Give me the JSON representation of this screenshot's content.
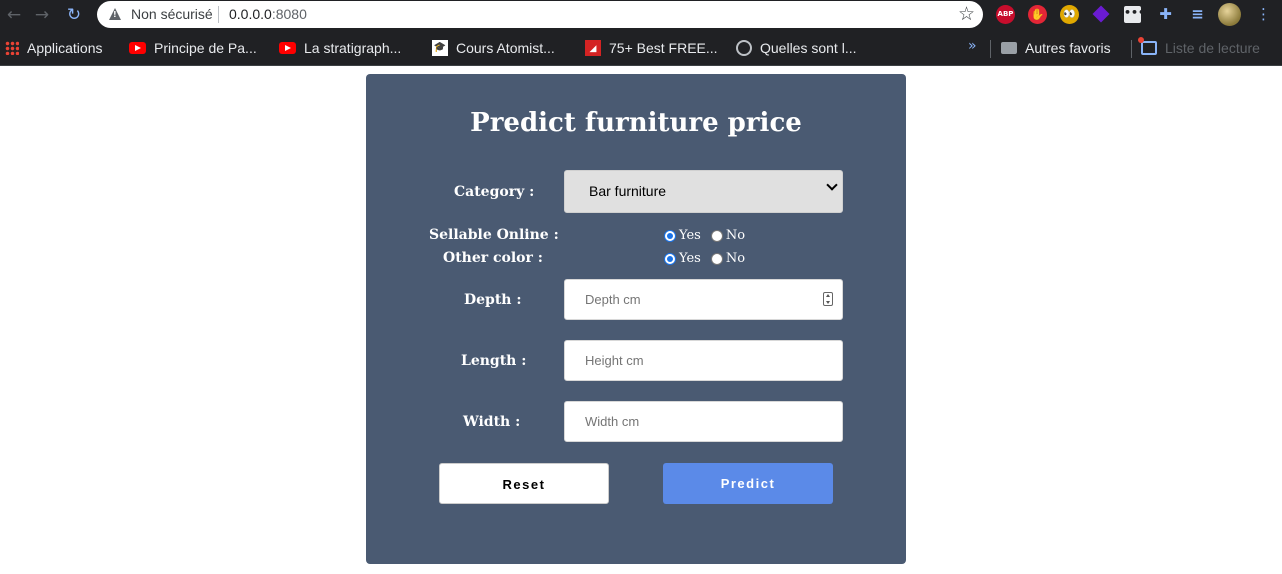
{
  "browser": {
    "security_text": "Non sécurisé",
    "url_host": "0.0.0.0",
    "url_port": ":8080",
    "extensions": [
      "ABP",
      "✋",
      "👀",
      "",
      "•••",
      "",
      ""
    ],
    "bookmarks": [
      {
        "label": "Applications"
      },
      {
        "label": "Principe de Pa..."
      },
      {
        "label": "La stratigraph..."
      },
      {
        "label": "Cours Atomist..."
      },
      {
        "label": "75+ Best FREE..."
      },
      {
        "label": "Quelles sont l..."
      }
    ],
    "bookmarks_overflow": "»",
    "other_bookmarks": "Autres favoris",
    "reading_list": "Liste de lecture"
  },
  "form": {
    "title": "Predict furniture price",
    "category_label": "Category :",
    "category_value": "Bar furniture",
    "sellable_label": "Sellable Online :",
    "other_color_label": "Other color :",
    "yes_label": "Yes",
    "no_label": "No",
    "sellable_selected": "Yes",
    "other_color_selected": "Yes",
    "depth_label": "Depth :",
    "depth_placeholder": "Depth cm",
    "length_label": "Length :",
    "length_placeholder": "Height cm",
    "width_label": "Width :",
    "width_placeholder": "Width cm",
    "reset_label": "Reset",
    "predict_label": "Predict"
  },
  "colors": {
    "card_bg": "#4a5a72",
    "predict_bg": "#5b8ae8"
  }
}
